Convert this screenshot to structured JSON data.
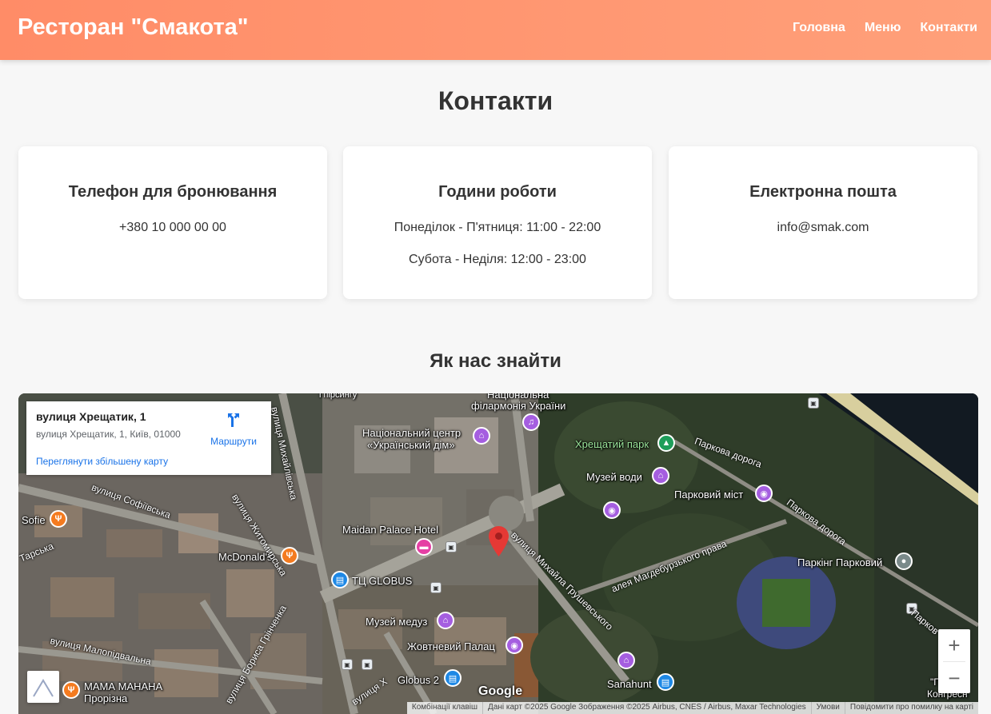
{
  "header": {
    "brand": "Ресторан \"Смакота\"",
    "nav": [
      "Головна",
      "Меню",
      "Контакти"
    ]
  },
  "page_title": "Контакти",
  "cards": [
    {
      "title": "Телефон для бронювання",
      "lines": [
        "+380 10 000 00 00"
      ]
    },
    {
      "title": "Години роботи",
      "lines": [
        "Понеділок - П'ятниця: 11:00 - 22:00",
        "Субота - Неділя: 12:00 - 23:00"
      ]
    },
    {
      "title": "Електронна пошта",
      "lines": [
        "info@smak.com"
      ]
    }
  ],
  "section_title": "Як нас знайти",
  "map": {
    "info": {
      "title": "вулиця Хрещатик, 1",
      "address": "вулиця Хрещатик, 1, Київ, 01000",
      "directions": "Маршрути",
      "larger_map": "Переглянути збільшену карту"
    },
    "places": {
      "philharmonic_1": "Національна",
      "philharmonic_2": "філармонія України",
      "ukr_dim_1": "Національний центр",
      "ukr_dim_2": "«Український дім»",
      "khreshchatyi_park": "Хрещатий парк",
      "water_museum": "Музей води",
      "park_bridge": "Парковий міст",
      "maidan_palace": "Maidan Palace Hotel",
      "mcdonalds": "McDonald's",
      "sofie": "Sofie",
      "globus": "ТЦ GLOBUS",
      "jellyfish_museum": "Музей медуз",
      "zhovtnevyi": "Жовтневий Палац",
      "globus2": "Globus 2",
      "mama_manana_1": "МАМА МАНАНА",
      "mama_manana_2": "Прорізна",
      "sanahunt": "Sanahunt",
      "parking": "Паркінг Парковий",
      "pirsynhu": "і пірсингу",
      "congress_1": "\"П",
      "congress_2": "Конгресн"
    },
    "streets": {
      "sofiivska": "вулиця Софіївська",
      "zhytomyrska": "вулиця Житомирська",
      "mykhailivska": "вулиця Михайлівська",
      "hrushevskoho": "вулиця Михайла Грушевського",
      "mahdeburzkoho": "алея Магдебурзького права",
      "parkova_1": "Паркова дорога",
      "parkova_2": "Паркова дорога",
      "parkova_3": "Парков",
      "hrinchenka": "вулиця Бориса Грінченка",
      "malopidvalna": "вулиця Малопідвальна",
      "tarska": "Тарська",
      "khreshch": "вулиця Х"
    },
    "zoom_in": "+",
    "zoom_out": "−",
    "google": "Google",
    "attribution": [
      "Комбінації клавіш",
      "Дані карт ©2025 Google Зображення ©2025 Airbus, CNES / Airbus, Maxar Technologies",
      "Умови",
      "Повідомити про помилку на карті"
    ]
  },
  "colors": {
    "accent": "#ff8c67",
    "accent_end": "#ffa07a",
    "pin": "#e53935"
  }
}
